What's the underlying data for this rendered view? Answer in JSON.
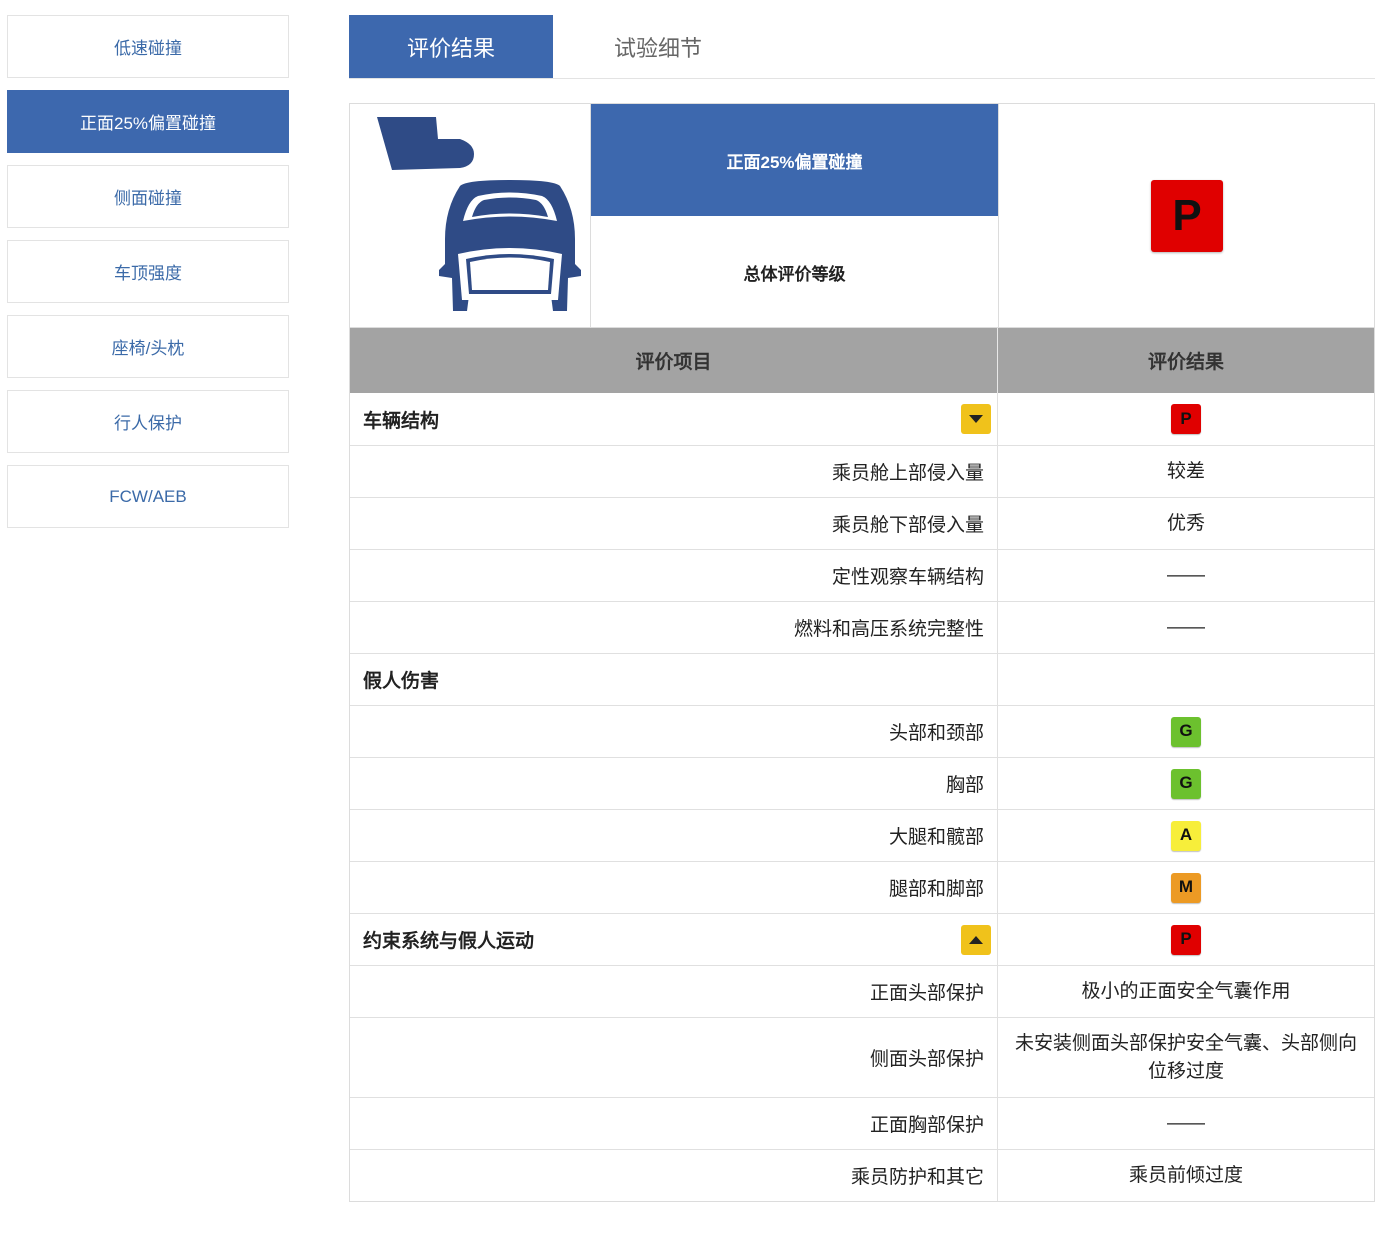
{
  "sidebar": {
    "items": [
      {
        "label": "低速碰撞",
        "active": false
      },
      {
        "label": "正面25%偏置碰撞",
        "active": true
      },
      {
        "label": "侧面碰撞",
        "active": false
      },
      {
        "label": "车顶强度",
        "active": false
      },
      {
        "label": "座椅/头枕",
        "active": false
      },
      {
        "label": "行人保护",
        "active": false
      },
      {
        "label": "FCW/AEB",
        "active": false
      }
    ]
  },
  "tabs": {
    "results": "评价结果",
    "details": "试验细节"
  },
  "summary": {
    "test_name": "正面25%偏置碰撞",
    "overall_label": "总体评价等级",
    "overall_rating": "P",
    "icon": "small-overlap-crash-icon"
  },
  "table": {
    "col_item": "评价项目",
    "col_result": "评价结果"
  },
  "sections": {
    "structure": {
      "title": "车辆结构",
      "rating": "P",
      "rows": [
        {
          "label": "乘员舱上部侵入量",
          "value": "较差"
        },
        {
          "label": "乘员舱下部侵入量",
          "value": "优秀"
        },
        {
          "label": "定性观察车辆结构",
          "value": "——"
        },
        {
          "label": "燃料和高压系统完整性",
          "value": "——"
        }
      ]
    },
    "injury": {
      "title": "假人伤害",
      "rows": [
        {
          "label": "头部和颈部",
          "rating": "G"
        },
        {
          "label": "胸部",
          "rating": "G"
        },
        {
          "label": "大腿和髋部",
          "rating": "A"
        },
        {
          "label": "腿部和脚部",
          "rating": "M"
        }
      ]
    },
    "restraint": {
      "title": "约束系统与假人运动",
      "rating": "P",
      "rows": [
        {
          "label": "正面头部保护",
          "value": "极小的正面安全气囊作用"
        },
        {
          "label": "侧面头部保护",
          "value": "未安装侧面头部保护安全气囊、头部侧向位移过度"
        },
        {
          "label": "正面胸部保护",
          "value": "——"
        },
        {
          "label": "乘员防护和其它",
          "value": "乘员前倾过度"
        }
      ]
    }
  },
  "colors": {
    "accent": "#3d68ae",
    "rating_P": "#e00000",
    "rating_G": "#6cc12e",
    "rating_A": "#f7ee3a",
    "rating_M": "#ec9a24",
    "toggle": "#f0c21b",
    "header_bg": "#a3a3a3"
  }
}
